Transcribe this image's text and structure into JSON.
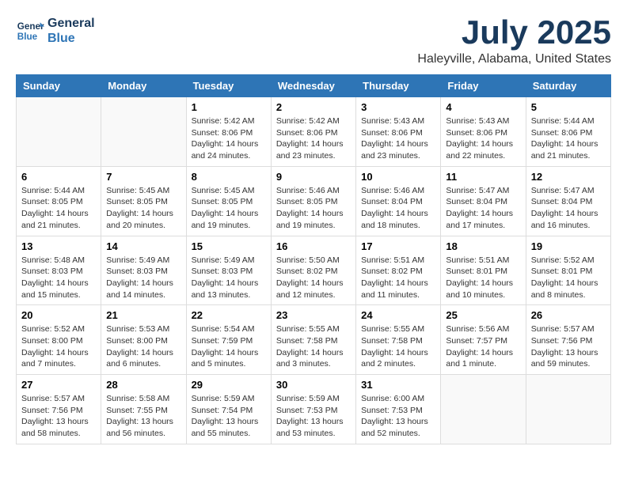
{
  "logo": {
    "line1": "General",
    "line2": "Blue"
  },
  "title": "July 2025",
  "location": "Haleyville, Alabama, United States",
  "weekdays": [
    "Sunday",
    "Monday",
    "Tuesday",
    "Wednesday",
    "Thursday",
    "Friday",
    "Saturday"
  ],
  "weeks": [
    [
      {
        "day": "",
        "text": ""
      },
      {
        "day": "",
        "text": ""
      },
      {
        "day": "1",
        "text": "Sunrise: 5:42 AM\nSunset: 8:06 PM\nDaylight: 14 hours and 24 minutes."
      },
      {
        "day": "2",
        "text": "Sunrise: 5:42 AM\nSunset: 8:06 PM\nDaylight: 14 hours and 23 minutes."
      },
      {
        "day": "3",
        "text": "Sunrise: 5:43 AM\nSunset: 8:06 PM\nDaylight: 14 hours and 23 minutes."
      },
      {
        "day": "4",
        "text": "Sunrise: 5:43 AM\nSunset: 8:06 PM\nDaylight: 14 hours and 22 minutes."
      },
      {
        "day": "5",
        "text": "Sunrise: 5:44 AM\nSunset: 8:06 PM\nDaylight: 14 hours and 21 minutes."
      }
    ],
    [
      {
        "day": "6",
        "text": "Sunrise: 5:44 AM\nSunset: 8:05 PM\nDaylight: 14 hours and 21 minutes."
      },
      {
        "day": "7",
        "text": "Sunrise: 5:45 AM\nSunset: 8:05 PM\nDaylight: 14 hours and 20 minutes."
      },
      {
        "day": "8",
        "text": "Sunrise: 5:45 AM\nSunset: 8:05 PM\nDaylight: 14 hours and 19 minutes."
      },
      {
        "day": "9",
        "text": "Sunrise: 5:46 AM\nSunset: 8:05 PM\nDaylight: 14 hours and 19 minutes."
      },
      {
        "day": "10",
        "text": "Sunrise: 5:46 AM\nSunset: 8:04 PM\nDaylight: 14 hours and 18 minutes."
      },
      {
        "day": "11",
        "text": "Sunrise: 5:47 AM\nSunset: 8:04 PM\nDaylight: 14 hours and 17 minutes."
      },
      {
        "day": "12",
        "text": "Sunrise: 5:47 AM\nSunset: 8:04 PM\nDaylight: 14 hours and 16 minutes."
      }
    ],
    [
      {
        "day": "13",
        "text": "Sunrise: 5:48 AM\nSunset: 8:03 PM\nDaylight: 14 hours and 15 minutes."
      },
      {
        "day": "14",
        "text": "Sunrise: 5:49 AM\nSunset: 8:03 PM\nDaylight: 14 hours and 14 minutes."
      },
      {
        "day": "15",
        "text": "Sunrise: 5:49 AM\nSunset: 8:03 PM\nDaylight: 14 hours and 13 minutes."
      },
      {
        "day": "16",
        "text": "Sunrise: 5:50 AM\nSunset: 8:02 PM\nDaylight: 14 hours and 12 minutes."
      },
      {
        "day": "17",
        "text": "Sunrise: 5:51 AM\nSunset: 8:02 PM\nDaylight: 14 hours and 11 minutes."
      },
      {
        "day": "18",
        "text": "Sunrise: 5:51 AM\nSunset: 8:01 PM\nDaylight: 14 hours and 10 minutes."
      },
      {
        "day": "19",
        "text": "Sunrise: 5:52 AM\nSunset: 8:01 PM\nDaylight: 14 hours and 8 minutes."
      }
    ],
    [
      {
        "day": "20",
        "text": "Sunrise: 5:52 AM\nSunset: 8:00 PM\nDaylight: 14 hours and 7 minutes."
      },
      {
        "day": "21",
        "text": "Sunrise: 5:53 AM\nSunset: 8:00 PM\nDaylight: 14 hours and 6 minutes."
      },
      {
        "day": "22",
        "text": "Sunrise: 5:54 AM\nSunset: 7:59 PM\nDaylight: 14 hours and 5 minutes."
      },
      {
        "day": "23",
        "text": "Sunrise: 5:55 AM\nSunset: 7:58 PM\nDaylight: 14 hours and 3 minutes."
      },
      {
        "day": "24",
        "text": "Sunrise: 5:55 AM\nSunset: 7:58 PM\nDaylight: 14 hours and 2 minutes."
      },
      {
        "day": "25",
        "text": "Sunrise: 5:56 AM\nSunset: 7:57 PM\nDaylight: 14 hours and 1 minute."
      },
      {
        "day": "26",
        "text": "Sunrise: 5:57 AM\nSunset: 7:56 PM\nDaylight: 13 hours and 59 minutes."
      }
    ],
    [
      {
        "day": "27",
        "text": "Sunrise: 5:57 AM\nSunset: 7:56 PM\nDaylight: 13 hours and 58 minutes."
      },
      {
        "day": "28",
        "text": "Sunrise: 5:58 AM\nSunset: 7:55 PM\nDaylight: 13 hours and 56 minutes."
      },
      {
        "day": "29",
        "text": "Sunrise: 5:59 AM\nSunset: 7:54 PM\nDaylight: 13 hours and 55 minutes."
      },
      {
        "day": "30",
        "text": "Sunrise: 5:59 AM\nSunset: 7:53 PM\nDaylight: 13 hours and 53 minutes."
      },
      {
        "day": "31",
        "text": "Sunrise: 6:00 AM\nSunset: 7:53 PM\nDaylight: 13 hours and 52 minutes."
      },
      {
        "day": "",
        "text": ""
      },
      {
        "day": "",
        "text": ""
      }
    ]
  ]
}
